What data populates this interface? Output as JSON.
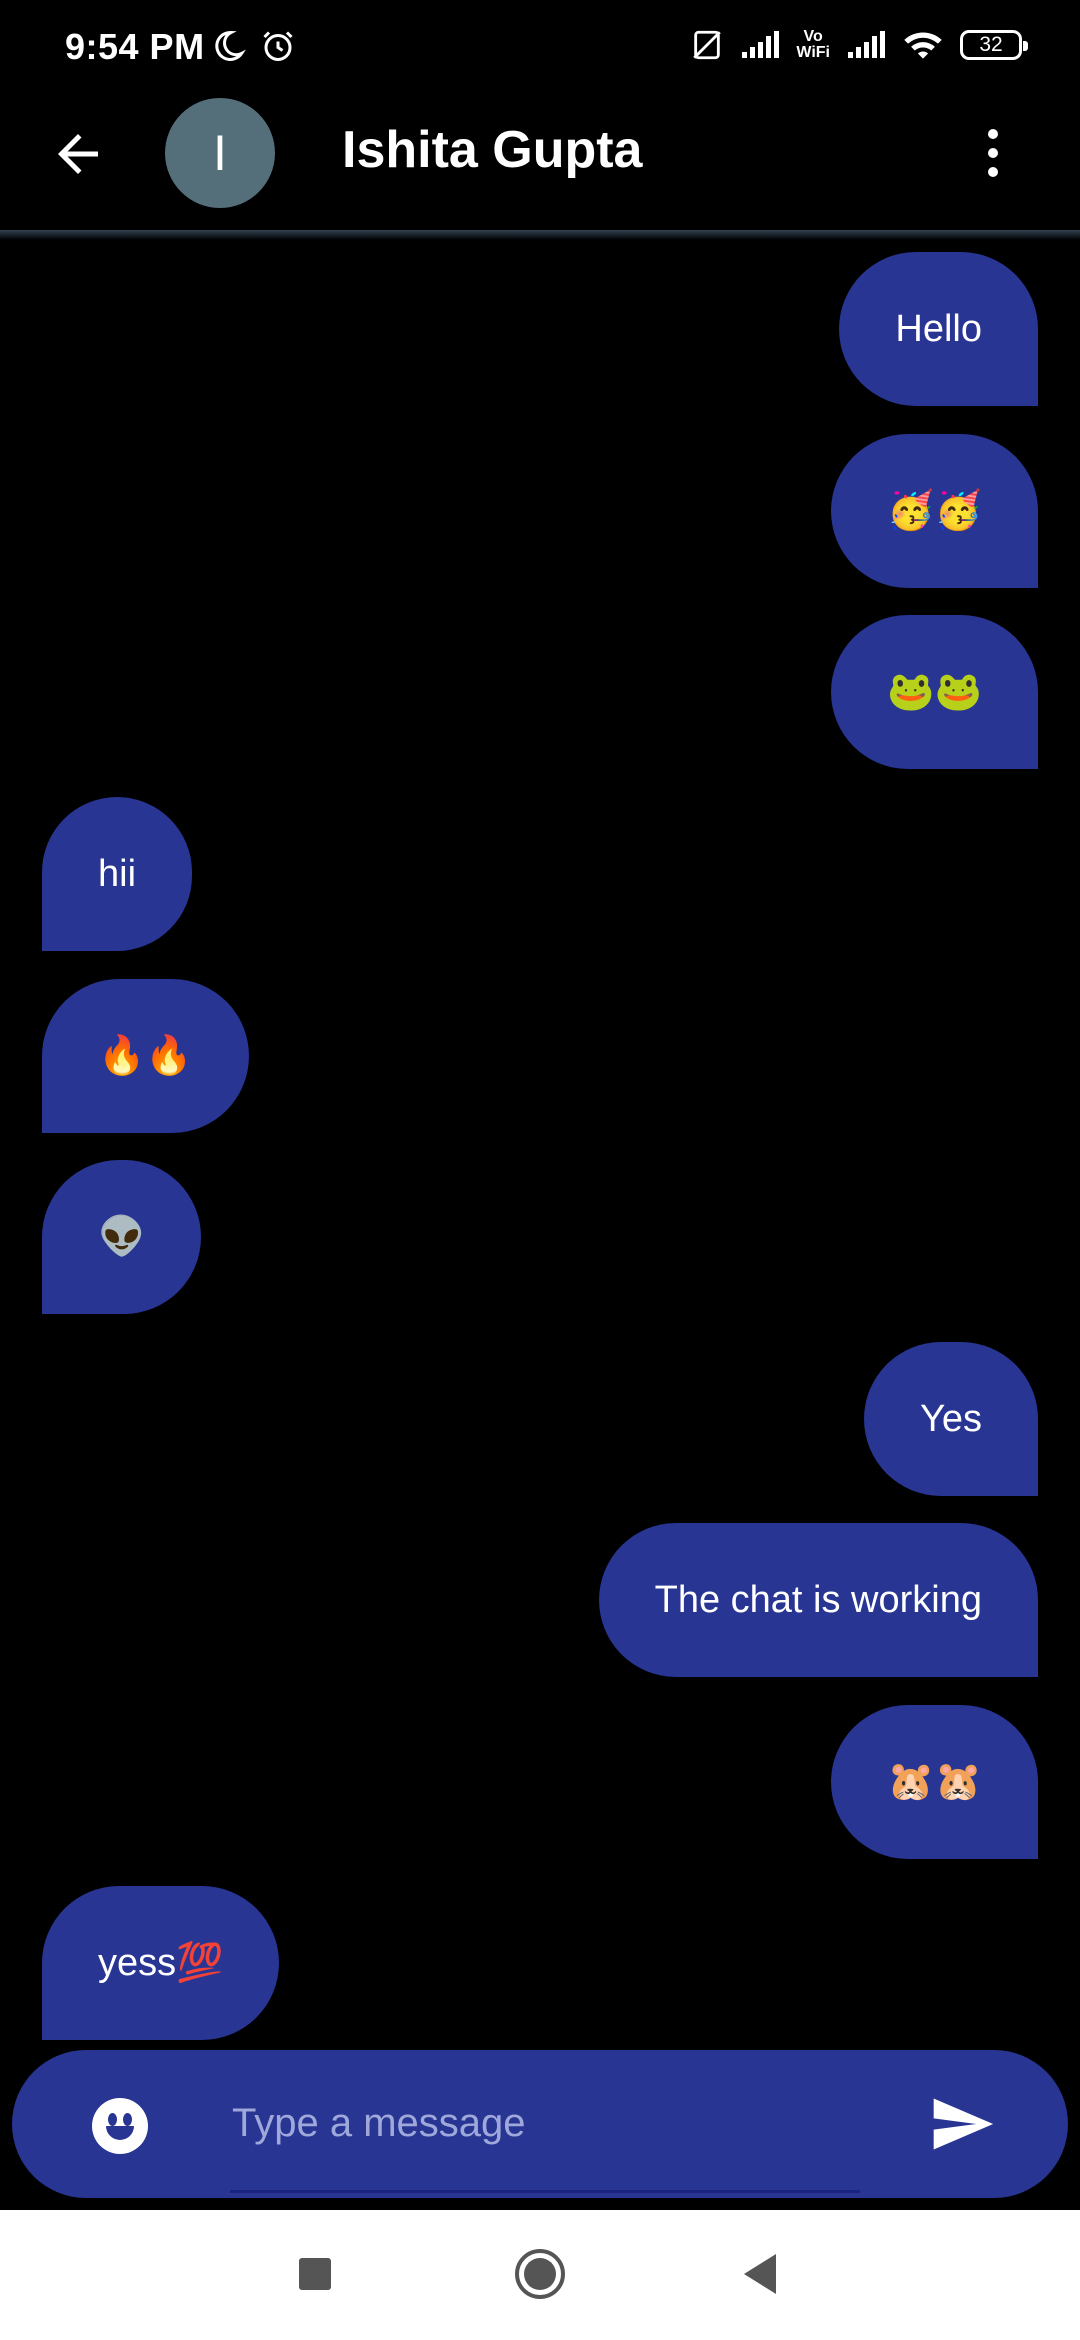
{
  "status_bar": {
    "time": "9:54 PM",
    "vowifi_top": "Vo",
    "vowifi_bottom": "WiFi",
    "battery": "32"
  },
  "header": {
    "avatar_letter": "I",
    "contact_name": "Ishita Gupta",
    "icons": [
      "back-arrow-icon",
      "more-vert-icon"
    ]
  },
  "messages": [
    {
      "side": "sent",
      "text": "Hello"
    },
    {
      "side": "sent",
      "text": "🥳🥳"
    },
    {
      "side": "sent",
      "text": "🐸🐸"
    },
    {
      "side": "received",
      "text": "hii"
    },
    {
      "side": "received",
      "text": "🔥🔥"
    },
    {
      "side": "received",
      "text": "👽"
    },
    {
      "side": "sent",
      "text": "Yes"
    },
    {
      "side": "sent",
      "text": "The chat is working"
    },
    {
      "side": "sent",
      "text": "🐹🐹"
    },
    {
      "side": "received",
      "text": "yess💯"
    }
  ],
  "composer": {
    "placeholder": "Type a message",
    "value": "",
    "icons": [
      "emoji-icon",
      "send-icon"
    ]
  },
  "colors": {
    "bubble": "#283593",
    "background": "#000000",
    "avatar": "#546e7a"
  }
}
